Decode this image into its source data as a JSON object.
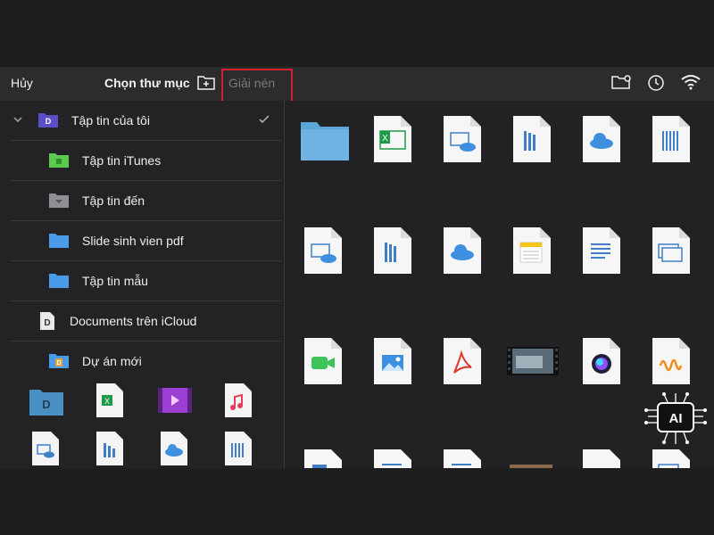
{
  "toolbar": {
    "cancel_label": "Hủy",
    "title": "Chọn thư mục",
    "extract_label": "Giải nén"
  },
  "sidebar": {
    "items": [
      {
        "label": "Tập tin của tôi"
      },
      {
        "label": "Tập tin iTunes"
      },
      {
        "label": "Tập tin đến"
      },
      {
        "label": "Slide sinh vien pdf"
      },
      {
        "label": "Tập tin mẫu"
      },
      {
        "label": "Documents trên iCloud"
      },
      {
        "label": "Dự án mới"
      }
    ]
  },
  "icons": {
    "grid": [
      "folder-icon",
      "excel-file-icon",
      "image-cloud-file-icon",
      "numbers-file-icon",
      "icloud-file-icon",
      "text-file-icon",
      "image-cloud-file-icon",
      "numbers-file-icon",
      "icloud-file-icon",
      "notes-file-icon",
      "text-file-icon",
      "keynote-file-icon",
      "facetime-file-icon",
      "image-file-icon",
      "pdf-file-icon",
      "video-thumbnail-icon",
      "siri-file-icon",
      "audio-file-icon"
    ],
    "badge": "ai-chip-icon"
  },
  "colors": {
    "accent": "#2f8ee6",
    "highlight": "#d8202a",
    "folder": "#4a9be8",
    "folder_green": "#5dc94e",
    "excel": "#1e9a48",
    "pdf": "#e0352b",
    "video_purple": "#9b3fd3"
  }
}
